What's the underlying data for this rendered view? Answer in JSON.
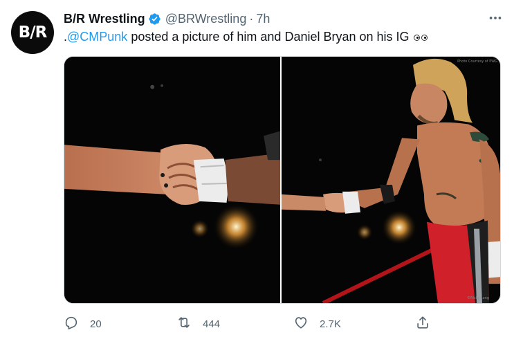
{
  "tweet": {
    "avatar_text": "B/R",
    "display_name": "B/R Wrestling",
    "handle": "@BRWrestling",
    "separator": "·",
    "time": "7h",
    "text_prefix": ".",
    "mention": "@CMPunk",
    "text_body": " posted a picture of him and Daniel Bryan on his IG",
    "emoji": "eyes-emoji",
    "photo_credit_text": "Photo Courtesy of PWG",
    "photo_credit_text_2": "©Ricky Long",
    "verified_color": "#1d9bf0",
    "link_color": "#1d9bf0",
    "muted_color": "#536471"
  },
  "actions": {
    "reply_count": "20",
    "retweet_count": "444",
    "like_count": "2.7K",
    "share_label": ""
  },
  "icons": [
    "more-icon",
    "verified-badge-icon",
    "reply-icon",
    "retweet-icon",
    "like-icon",
    "share-icon"
  ]
}
